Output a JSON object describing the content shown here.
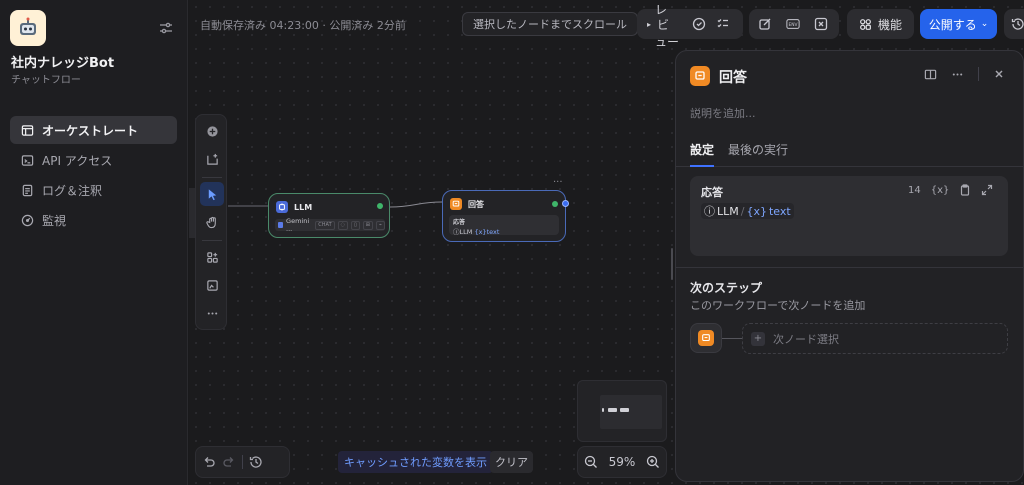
{
  "app": {
    "name": "社内ナレッジBot",
    "type": "チャットフロー"
  },
  "sidebar": {
    "items": [
      {
        "label": "オーケストレート",
        "active": true
      },
      {
        "label": "API アクセス"
      },
      {
        "label": "ログ＆注釈"
      },
      {
        "label": "監視"
      }
    ]
  },
  "topbar": {
    "save_status": "自動保存済み 04:23:00 · 公開済み 2分前",
    "scroll_label": "選択したノードまでスクロール",
    "preview_label": "ビ",
    "preview_vertical": "レ\n\nュー",
    "feature_label": "機能",
    "publish_label": "公開する"
  },
  "nodes": {
    "llm": {
      "title": "LLM",
      "model": "Gemini ...",
      "mode_tag": "CHAT"
    },
    "answer": {
      "title": "回答",
      "field_label": "応答",
      "var_source": "LLM",
      "var_name": "text"
    }
  },
  "bottom": {
    "cache_link": "キャッシュされた変数を表示",
    "clear_label": "クリア",
    "zoom": "59%"
  },
  "panel": {
    "title": "回答",
    "description_placeholder": "説明を追加...",
    "tabs": [
      "設定",
      "最後の実行"
    ],
    "response": {
      "label": "応答",
      "count": "14",
      "var_source": "LLM",
      "var_name": "text"
    },
    "next_step": {
      "title": "次のステップ",
      "description": "このワークフローで次ノードを追加",
      "select_placeholder": "次ノード選択"
    }
  },
  "colors": {
    "accent": "#2563eb",
    "answer_node": "#f08a24",
    "llm_node": "#4a6ad8",
    "status_ok": "#3fb56a"
  }
}
